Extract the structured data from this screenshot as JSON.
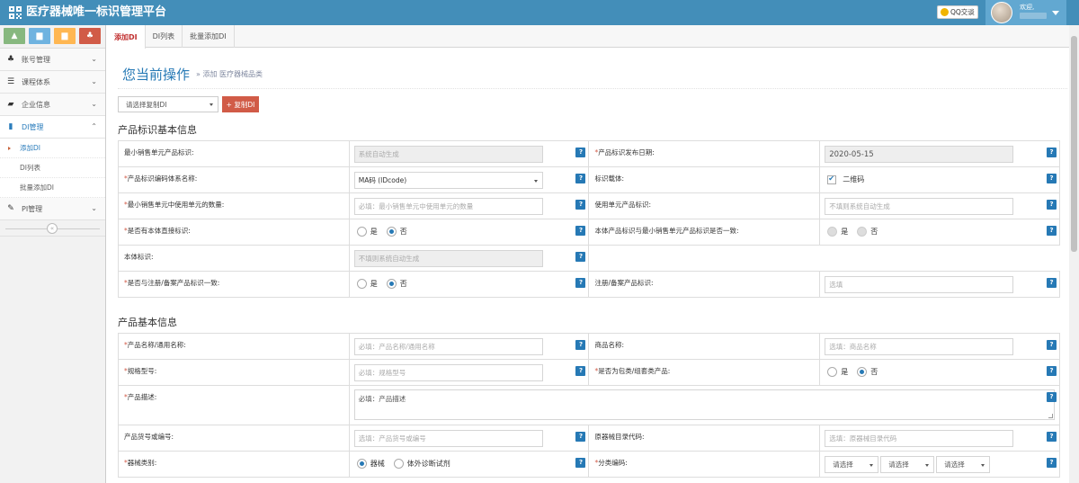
{
  "header": {
    "app_title": "医疗器械唯一标识管理平台",
    "qq_label": "QQ交谈",
    "welcome": "欢迎,"
  },
  "sidebar": {
    "shortcut_colors": [
      "#87b87f",
      "#6fb3e0",
      "#ffb752",
      "#d15b47"
    ],
    "items": [
      {
        "label": "账号管理",
        "icon": "users-icon"
      },
      {
        "label": "课程体系",
        "icon": "list-icon"
      },
      {
        "label": "企业信息",
        "icon": "folder-icon"
      },
      {
        "label": "DI管理",
        "icon": "book-icon"
      },
      {
        "label": "PI管理",
        "icon": "wrench-icon"
      }
    ],
    "sub_items": [
      "添加DI",
      "DI列表",
      "批量添加DI"
    ]
  },
  "tabs": [
    "添加DI",
    "DI列表",
    "批量添加DI"
  ],
  "page": {
    "title": "您当前操作",
    "breadcrumb": "» 添加 医疗器械品类",
    "copy_select_placeholder": "请选择复制DI",
    "copy_button": "+ 复制DI"
  },
  "section1": {
    "title": "产品标识基本信息",
    "min_unit_label": "最小销售单元产品标识:",
    "min_unit_value": "系统自动生成",
    "release_date_label": "产品标识发布日期:",
    "release_date_value": "2020-05-15",
    "code_system_label": "产品标识编码体系名称:",
    "code_system_value": "MA码 (IDcode)",
    "carrier_label": "标识载体:",
    "carrier_value": "二维码",
    "unit_count_label": "最小销售单元中使用单元的数量:",
    "unit_count_placeholder": "必填：最小销售单元中使用单元的数量",
    "use_unit_label": "使用单元产品标识:",
    "use_unit_placeholder": "不填则系统自动生成",
    "direct_mark_label": "是否有本体直接标识:",
    "consistent_label": "本体产品标识与最小销售单元产品标识是否一致:",
    "body_mark_label": "本体标识:",
    "body_mark_placeholder": "不填则系统自动生成",
    "reg_consistent_label": "是否与注册/备案产品标识一致:",
    "reg_mark_label": "注册/备案产品标识:",
    "reg_mark_placeholder": "选填",
    "yes": "是",
    "no": "否"
  },
  "section2": {
    "title": "产品基本信息",
    "name_label": "产品名称/通用名称:",
    "name_placeholder": "必填：产品名称/通用名称",
    "trade_label": "商品名称:",
    "trade_placeholder": "选填：商品名称",
    "spec_label": "规格型号:",
    "spec_placeholder": "必填：规格型号",
    "pack_label": "是否为包类/组套类产品:",
    "desc_label": "产品描述:",
    "desc_placeholder": "必填：产品描述",
    "item_no_label": "产品货号或编号:",
    "item_no_placeholder": "选填：产品货号或编号",
    "catalog_label": "原器械目录代码:",
    "catalog_placeholder": "选填：原器械目录代码",
    "category_label": "器械类别:",
    "cat_device": "器械",
    "cat_ivd": "体外诊断试剂",
    "class_code_label": "分类编码:",
    "select_placeholder": "请选择",
    "yes": "是",
    "no": "否"
  }
}
